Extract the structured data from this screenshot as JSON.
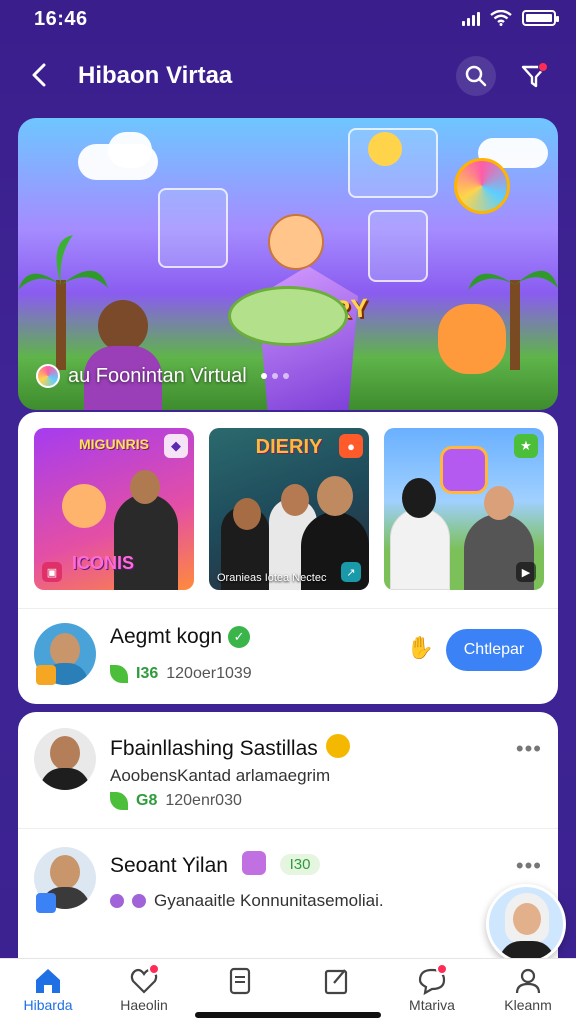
{
  "status": {
    "time": "16:46"
  },
  "header": {
    "title": "Hibaon Virtaa",
    "search_icon": "search-icon",
    "filter_icon": "filter-icon"
  },
  "hero": {
    "logo": "VIRURY",
    "caption": "au Foonintan Virtual"
  },
  "thumbs": [
    {
      "title": "MIGUNRIS",
      "subtitle": "ICONIS",
      "footer": ""
    },
    {
      "title": "DIERIY",
      "footer": "Oranieas Iotea Nectec"
    },
    {
      "title": "",
      "footer": ""
    }
  ],
  "live": {
    "name": "Aegmt kogn",
    "stat": "I36",
    "meta": "120oer1039",
    "cta": "Chtlepar"
  },
  "feed": [
    {
      "name": "Fbainllashing Sastillas",
      "sub": "AoobensKantad arlamaegrim",
      "stat": "G8",
      "meta": "120enr030"
    },
    {
      "name": "Seoant Yilan",
      "pill": "I30",
      "sub": "Gyanaaitle Konnunitasemoliai."
    }
  ],
  "nav": [
    {
      "label": "Hibarda",
      "icon": "home-icon",
      "active": true
    },
    {
      "label": "Haeolin",
      "icon": "heart-icon"
    },
    {
      "label": "",
      "icon": "document-icon"
    },
    {
      "label": "",
      "icon": "compose-icon"
    },
    {
      "label": "Mtariva",
      "icon": "chat-icon"
    },
    {
      "label": "Kleanm",
      "icon": "profile-icon"
    }
  ],
  "colors": {
    "bg": "#3a1e8c",
    "accent": "#3b82f6",
    "active_nav": "#1f6fe5",
    "badge": "#ff2d55"
  }
}
